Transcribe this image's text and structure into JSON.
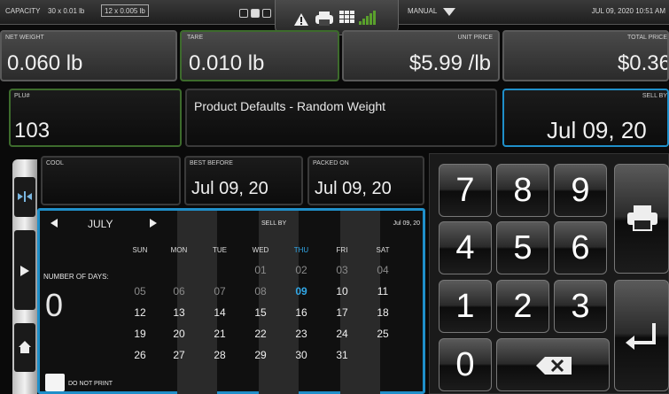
{
  "topbar": {
    "capacity_label": "CAPACITY",
    "capacity_range1": "30 x 0.01 lb",
    "capacity_range2": "12 x 0.005 lb",
    "mode": "MANUAL",
    "datetime": "JUL 09, 2020 10:51 AM"
  },
  "fields": {
    "net_weight": {
      "label": "NET WEIGHT",
      "value": "0.060 lb"
    },
    "tare": {
      "label": "TARE",
      "value": "0.010 lb"
    },
    "unit_price": {
      "label": "UNIT PRICE",
      "value": "$5.99 /lb"
    },
    "total_price": {
      "label": "TOTAL PRICE",
      "value": "$0.36"
    },
    "plu": {
      "label": "PLU#",
      "value": "103"
    },
    "description": {
      "value": "Product Defaults - Random Weight"
    },
    "sell_by_top": {
      "label": "SELL BY",
      "value": "Jul 09, 20"
    },
    "cool": {
      "label": "COOL"
    },
    "best_before": {
      "label": "BEST BEFORE",
      "value": "Jul 09, 20"
    },
    "packed_on": {
      "label": "PACKED ON",
      "value": "Jul 09, 20"
    }
  },
  "calendar": {
    "month": "JULY",
    "header_label": "SELL BY",
    "header_date": "Jul 09, 20",
    "days_label": "NUMBER OF DAYS:",
    "days_value": "0",
    "do_not_print": "DO NOT PRINT",
    "weekdays": [
      "SUN",
      "MON",
      "TUE",
      "WED",
      "THU",
      "FRI",
      "SAT"
    ],
    "weeks": [
      [
        "",
        "",
        "",
        "01",
        "02",
        "03",
        "04"
      ],
      [
        "05",
        "06",
        "07",
        "08",
        "09",
        "10",
        "11"
      ],
      [
        "12",
        "13",
        "14",
        "15",
        "16",
        "17",
        "18"
      ],
      [
        "19",
        "20",
        "21",
        "22",
        "23",
        "24",
        "25"
      ],
      [
        "26",
        "27",
        "28",
        "29",
        "30",
        "31",
        ""
      ]
    ],
    "selected": "09"
  },
  "keypad": {
    "keys": [
      "7",
      "8",
      "9",
      "4",
      "5",
      "6",
      "1",
      "2",
      "3",
      "0"
    ]
  },
  "colors": {
    "accent_blue": "#1f8fc9",
    "accent_green": "#3d6b2c",
    "selected_day": "#32a8e8"
  }
}
